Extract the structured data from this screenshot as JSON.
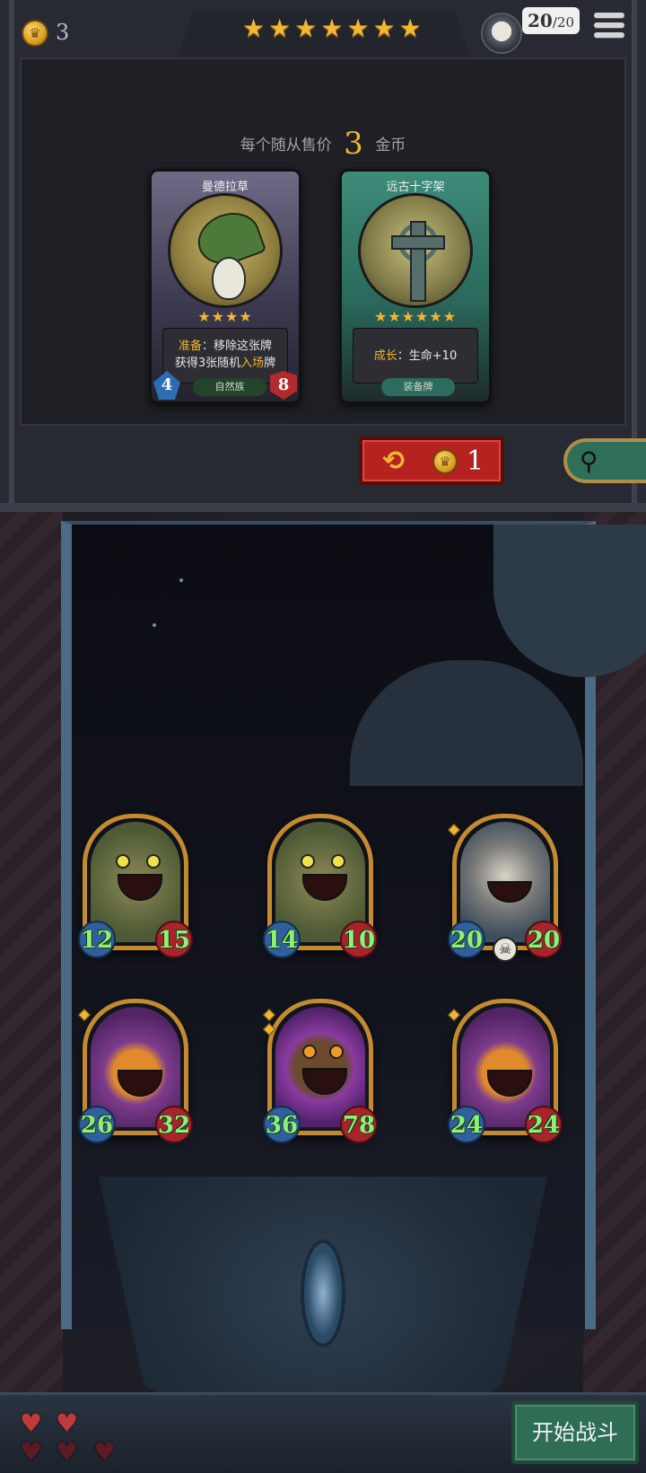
{
  "header": {
    "gold": "3",
    "tier_stars": 7,
    "health": "20",
    "health_max": "/20",
    "menu_icon": "hamburger-menu-icon"
  },
  "shop": {
    "price_prefix": "每个随从售价",
    "price_value": "3",
    "price_suffix": "金币",
    "cards": [
      {
        "name": "曼德拉草",
        "stars": 4,
        "text_kw": "准备",
        "text_line1": "：移除这张牌",
        "text_line2a": "获得3张随机",
        "text_line2_kw": "入场",
        "text_line2b": "牌",
        "tribe": "自然族",
        "attack": "4",
        "health": "8"
      },
      {
        "name": "远古十字架",
        "stars": 6,
        "text_kw": "成长",
        "text_rest": "：生命+10",
        "tribe": "装备牌"
      }
    ],
    "refresh_cost": "1",
    "colors": {
      "refresh": "#b5221f",
      "search": "#2f6e58",
      "gold": "#f0b534"
    }
  },
  "board": {
    "minions": [
      {
        "attack": "12",
        "health": "15",
        "art": "olive-beast"
      },
      {
        "attack": "14",
        "health": "10",
        "art": "olive-beast"
      },
      {
        "attack": "20",
        "health": "20",
        "art": "grey-demon"
      },
      {
        "attack": "26",
        "health": "32",
        "art": "pumpkin"
      },
      {
        "attack": "36",
        "health": "78",
        "art": "wooden-mask"
      },
      {
        "attack": "24",
        "health": "24",
        "art": "pumpkin"
      }
    ],
    "stat_color": "#8ef07a"
  },
  "footer": {
    "lives_full": 2,
    "lives_total": 5,
    "start_battle": "开始战斗"
  }
}
